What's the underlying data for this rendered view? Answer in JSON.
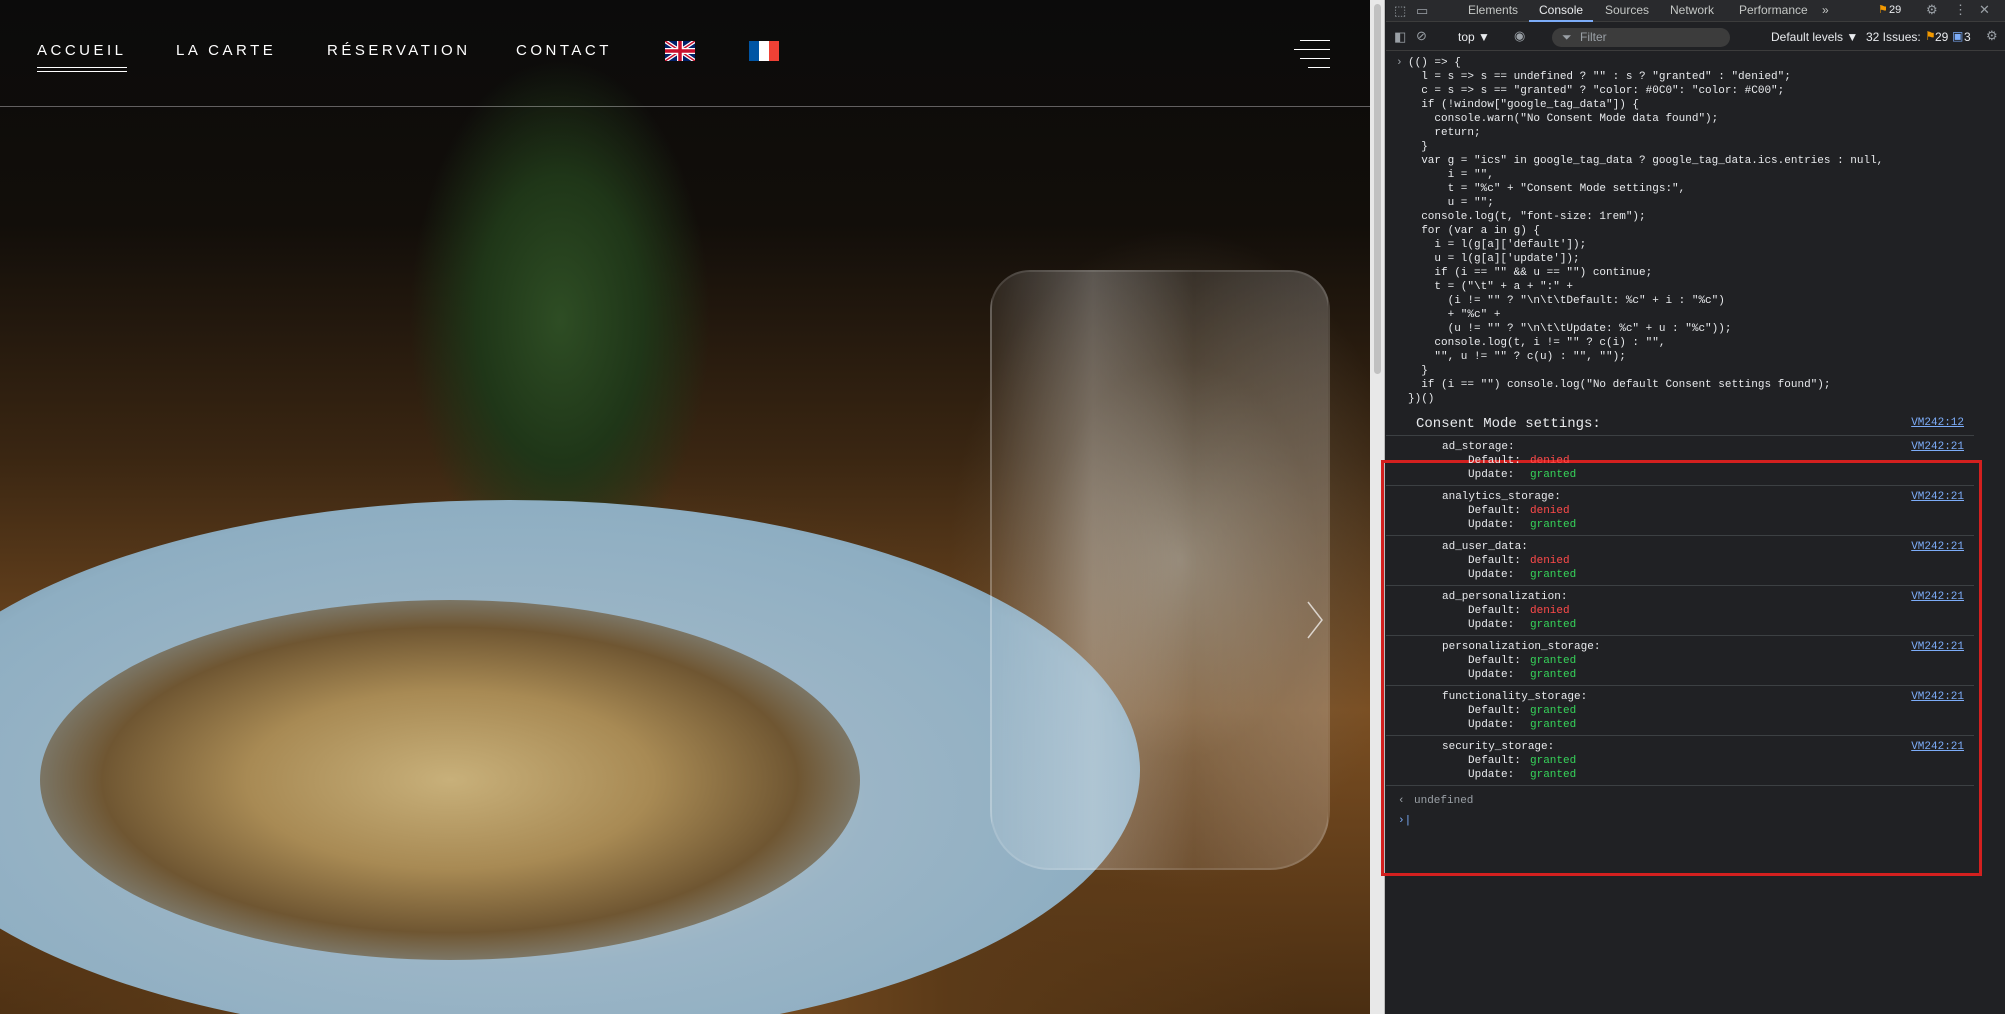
{
  "website": {
    "nav": {
      "items": [
        {
          "label": "ACCUEIL",
          "active": true
        },
        {
          "label": "LA CARTE",
          "active": false
        },
        {
          "label": "RÉSERVATION",
          "active": false
        },
        {
          "label": "CONTACT",
          "active": false
        }
      ],
      "flags": [
        "uk-flag-icon",
        "france-flag-icon"
      ],
      "menu_icon": "hamburger-menu-icon"
    },
    "slider_arrow": "chevron-right-icon"
  },
  "devtools": {
    "tabs": [
      "Elements",
      "Console",
      "Sources",
      "Network",
      "Performance"
    ],
    "active_tab": "Console",
    "more_tabs": "»",
    "issues_badge": "29",
    "toolbar": {
      "context": "top ▼",
      "filter_placeholder": "Filter",
      "levels": "Default levels ▼",
      "issues_label": "32 Issues:",
      "issues_warn": "29",
      "issues_info": "3"
    },
    "console": {
      "code_lines": [
        "(() => {",
        "  l = s => s == undefined ? \"\" : s ? \"granted\" : \"denied\";",
        "  c = s => s == \"granted\" ? \"color: #0C0\": \"color: #C00\";",
        "  if (!window[\"google_tag_data\"]) {",
        "    console.warn(\"No Consent Mode data found\");",
        "    return;",
        "  }",
        "  var g = \"ics\" in google_tag_data ? google_tag_data.ics.entries : null,",
        "      i = \"\",",
        "      t = \"%c\" + \"Consent Mode settings:\",",
        "      u = \"\";",
        "  console.log(t, \"font-size: 1rem\");",
        "  for (var a in g) {",
        "    i = l(g[a]['default']);",
        "    u = l(g[a]['update']);",
        "    if (i == \"\" && u == \"\") continue;",
        "    t = (\"\\t\" + a + \":\" +",
        "      (i != \"\" ? \"\\n\\t\\tDefault: %c\" + i : \"%c\")",
        "      + \"%c\" +",
        "      (u != \"\" ? \"\\n\\t\\tUpdate: %c\" + u : \"%c\"));",
        "    console.log(t, i != \"\" ? c(i) : \"\",",
        "    \"\", u != \"\" ? c(u) : \"\", \"\");",
        "  }",
        "  if (i == \"\") console.log(\"No default Consent settings found\");",
        "})()"
      ],
      "header": {
        "text": "Consent Mode settings:",
        "link": "VM242:12"
      },
      "default_label": "Default:",
      "update_label": "Update:",
      "entries": [
        {
          "name": "ad_storage:",
          "default": "denied",
          "update": "granted",
          "link": "VM242:21"
        },
        {
          "name": "analytics_storage:",
          "default": "denied",
          "update": "granted",
          "link": "VM242:21"
        },
        {
          "name": "ad_user_data:",
          "default": "denied",
          "update": "granted",
          "link": "VM242:21"
        },
        {
          "name": "ad_personalization:",
          "default": "denied",
          "update": "granted",
          "link": "VM242:21"
        },
        {
          "name": "personalization_storage:",
          "default": "granted",
          "update": "granted",
          "link": "VM242:21"
        },
        {
          "name": "functionality_storage:",
          "default": "granted",
          "update": "granted",
          "link": "VM242:21"
        },
        {
          "name": "security_storage:",
          "default": "granted",
          "update": "granted",
          "link": "VM242:21"
        }
      ],
      "result": "undefined"
    }
  },
  "colors": {
    "granted": "#36d45a",
    "denied": "#ff4a4a",
    "highlight": "#d3201f"
  }
}
